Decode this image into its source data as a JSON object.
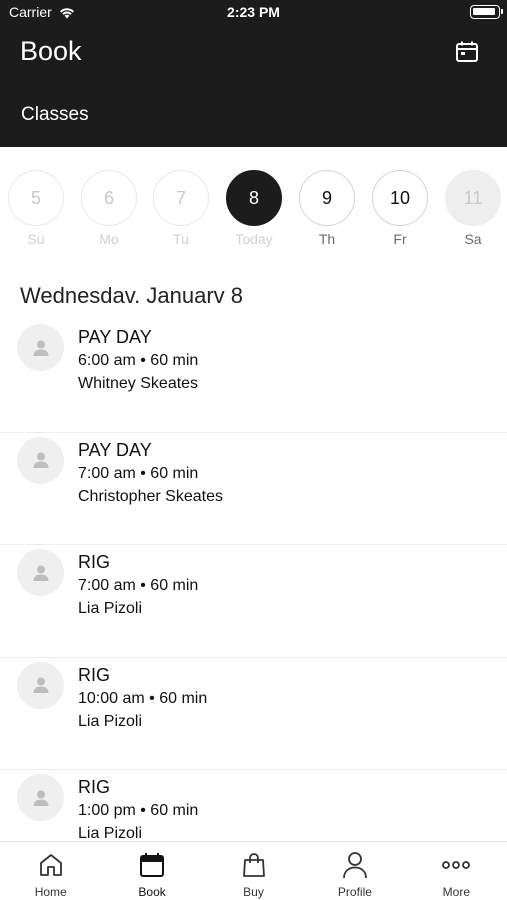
{
  "status_bar": {
    "carrier": "Carrier",
    "time": "2:23 PM"
  },
  "header": {
    "title": "Book",
    "tab": "Classes"
  },
  "days": [
    {
      "number": "5",
      "label": "Su",
      "state": "past"
    },
    {
      "number": "6",
      "label": "Mo",
      "state": "past"
    },
    {
      "number": "7",
      "label": "Tu",
      "state": "past"
    },
    {
      "number": "8",
      "label": "Today",
      "state": "today"
    },
    {
      "number": "9",
      "label": "Th",
      "state": "future"
    },
    {
      "number": "10",
      "label": "Fr",
      "state": "future"
    },
    {
      "number": "11",
      "label": "Sa",
      "state": "sat"
    }
  ],
  "date_heading": "Wednesdav. Januarv 8",
  "classes": [
    {
      "name": "PAY DAY",
      "time": "6:00 am • 60 min",
      "instructor": "Whitney Skeates"
    },
    {
      "name": "PAY DAY",
      "time": "7:00 am • 60 min",
      "instructor": "Christopher Skeates"
    },
    {
      "name": "RIG",
      "time": "7:00 am • 60 min",
      "instructor": "Lia Pizoli"
    },
    {
      "name": "RIG",
      "time": "10:00 am • 60 min",
      "instructor": "Lia Pizoli"
    },
    {
      "name": "RIG",
      "time": "1:00 pm • 60 min",
      "instructor": "Lia Pizoli"
    }
  ],
  "tab_bar": [
    {
      "label": "Home",
      "icon": "home-icon"
    },
    {
      "label": "Book",
      "icon": "calendar-icon"
    },
    {
      "label": "Buy",
      "icon": "shopping-bag-icon"
    },
    {
      "label": "Profile",
      "icon": "person-icon"
    },
    {
      "label": "More",
      "icon": "more-icon"
    }
  ],
  "colors": {
    "header_bg": "#1c1c1c",
    "selected_day": "#1c1c1c",
    "avatar_bg": "#efefef"
  }
}
